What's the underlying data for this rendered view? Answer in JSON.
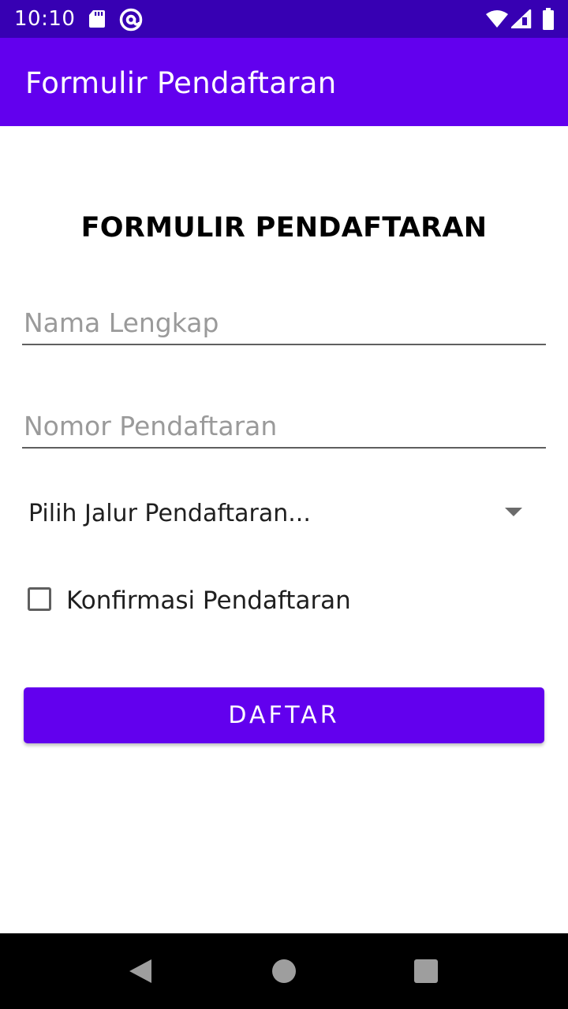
{
  "status_bar": {
    "time": "10:10",
    "background_color": "#3700b3",
    "icons": [
      "sd-card-icon",
      "at-sign-icon",
      "wifi-icon",
      "cell-signal-icon",
      "battery-icon"
    ]
  },
  "app_bar": {
    "title": "Formulir Pendaftaran",
    "background_color": "#6200ee"
  },
  "form": {
    "heading": "FORMULIR PENDAFTARAN",
    "name_field": {
      "value": "",
      "placeholder": "Nama Lengkap"
    },
    "registration_number_field": {
      "value": "",
      "placeholder": "Nomor Pendaftaran"
    },
    "track_spinner": {
      "selected": "Pilih Jalur Pendaftaran...",
      "icon": "dropdown-arrow-icon"
    },
    "confirm_checkbox": {
      "label": "Konfirmasi Pendaftaran",
      "checked": false
    },
    "submit_button": {
      "label": "DAFTAR",
      "color": "#6200ee"
    }
  },
  "nav_bar": {
    "icons": [
      "back-icon",
      "home-icon",
      "recents-icon"
    ]
  }
}
